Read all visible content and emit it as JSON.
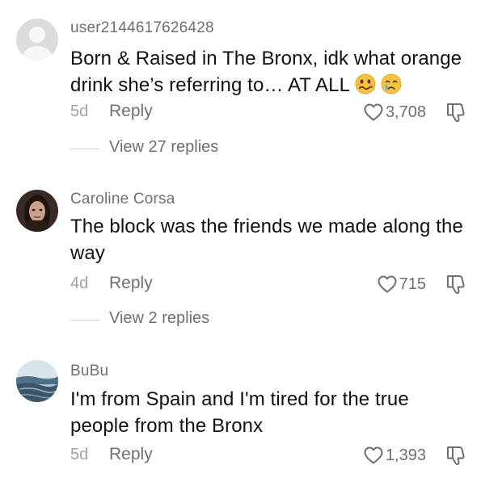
{
  "comments": [
    {
      "username": "user2144617626428",
      "text": "Born & Raised in The Bronx, idk what orange drink she’s referring to… AT ALL",
      "emojis": [
        "face-with-wavy-mouth",
        "crying-face"
      ],
      "age": "5d",
      "reply_label": "Reply",
      "likes": "3,708",
      "view_replies": "View 27 replies"
    },
    {
      "username": "Caroline Corsa",
      "text": "The block was the friends we made along the way",
      "age": "4d",
      "reply_label": "Reply",
      "likes": "715",
      "view_replies": "View 2 replies"
    },
    {
      "username": "BuBu",
      "text": "I'm from Spain and I'm tired for the true people from the Bronx",
      "age": "5d",
      "reply_label": "Reply",
      "likes": "1,393"
    }
  ],
  "icons": {
    "like": "heart-outline-icon",
    "dislike": "thumbs-down-icon"
  },
  "colors": {
    "text": "#111111",
    "secondary": "#6f6f6f",
    "muted": "#a3a3a3",
    "background": "#ffffff"
  }
}
